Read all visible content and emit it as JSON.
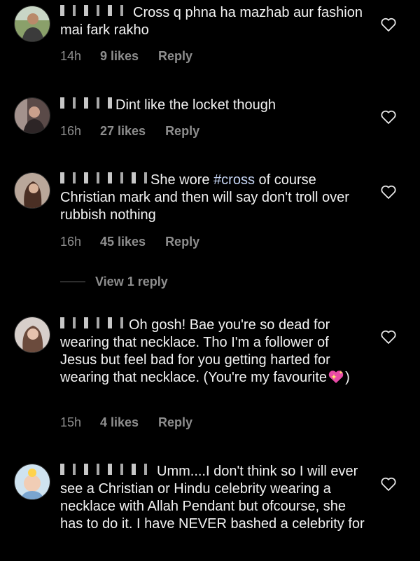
{
  "comments": [
    {
      "username": "z.k",
      "text": "Cross q phna ha mazhab aur fashion mai fark rakho",
      "time": "14h",
      "likes": "9 likes",
      "reply_label": "Reply",
      "avatar": "man-outdoors-avatar"
    },
    {
      "username": "..",
      "text": "Dint like the locket though",
      "time": "16h",
      "likes": "27 likes",
      "reply_label": "Reply",
      "avatar": "woman-room-avatar"
    },
    {
      "username": "a",
      "text_pre": "She wore ",
      "hashtag": "#cross",
      "text_post": " of course Christian mark and then will say don't troll over rubbish nothing",
      "time": "16h",
      "likes": "45 likes",
      "reply_label": "Reply",
      "avatar": "woman-long-hair-avatar"
    },
    {
      "username": "..",
      "text": "Oh gosh! Bae you're so dead for wearing that necklace. Tho I'm a follower of Jesus but feel bad for you getting harted for wearing that necklace. (You're my favourite",
      "text_end": ")",
      "time": "15h",
      "likes": "4 likes",
      "reply_label": "Reply",
      "avatar": "woman-portrait-avatar"
    },
    {
      "username": "s..",
      "text": "Umm....I don't think so I will ever see a Christian or Hindu celebrity wearing a necklace with Allah Pendant but ofcourse, she has to do it. I have NEVER bashed a celebrity for",
      "avatar": "baby-avatar"
    }
  ],
  "view_replies_label": "View 1 reply",
  "colors": {
    "background": "#000000",
    "text": "#f2f2f2",
    "meta": "#8e8e8e",
    "hashtag": "#c7d6f5"
  }
}
